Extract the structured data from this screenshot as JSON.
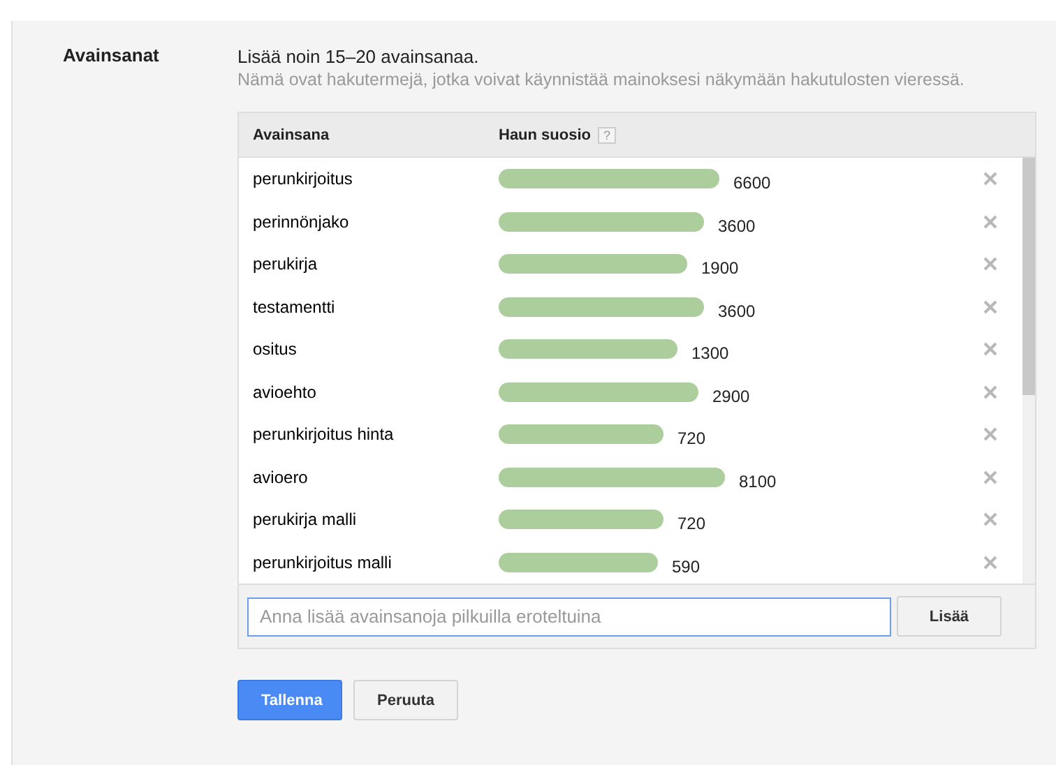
{
  "section_label": "Avainsanat",
  "intro": "Lisää noin 15–20 avainsanaa.",
  "hint": "Nämä ovat hakutermejä, jotka voivat käynnistää mainoksesi näkymään hakutulosten vieressä.",
  "table": {
    "columns": [
      "Avainsana",
      "Haun suosio"
    ],
    "help": "?",
    "rows": [
      {
        "keyword": "perunkirjoitus",
        "volume": "6600"
      },
      {
        "keyword": "perinnönjako",
        "volume": "3600"
      },
      {
        "keyword": "perukirja",
        "volume": "1900"
      },
      {
        "keyword": "testamentti",
        "volume": "3600"
      },
      {
        "keyword": "ositus",
        "volume": "1300"
      },
      {
        "keyword": "avioehto",
        "volume": "2900"
      },
      {
        "keyword": "perunkirjoitus hinta",
        "volume": "720"
      },
      {
        "keyword": "avioero",
        "volume": "8100"
      },
      {
        "keyword": "perukirja malli",
        "volume": "720"
      },
      {
        "keyword": "perunkirjoitus malli",
        "volume": "590"
      }
    ]
  },
  "add_field": {
    "placeholder": "Anna lisää avainsanoja pilkuilla eroteltuina"
  },
  "add_button": "Lisää",
  "buttons": [
    "Tallenna",
    "Peruuta"
  ]
}
